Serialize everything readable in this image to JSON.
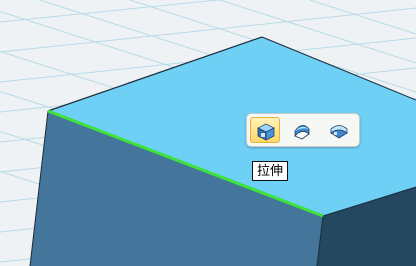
{
  "viewport": {
    "background_color": "#eef2f5",
    "grid_color": "#b9dbe9",
    "top_face_color": "#6fd0f5",
    "front_face_color": "#43769a",
    "right_face_color": "#24485f",
    "selected_edge_color": "#3de23a"
  },
  "toolbar": {
    "tools": [
      {
        "icon": "extrude-icon",
        "active": true
      },
      {
        "icon": "revolve-icon",
        "active": false
      },
      {
        "icon": "sweep-icon",
        "active": false
      }
    ]
  },
  "tooltip": {
    "text": "拉伸"
  }
}
